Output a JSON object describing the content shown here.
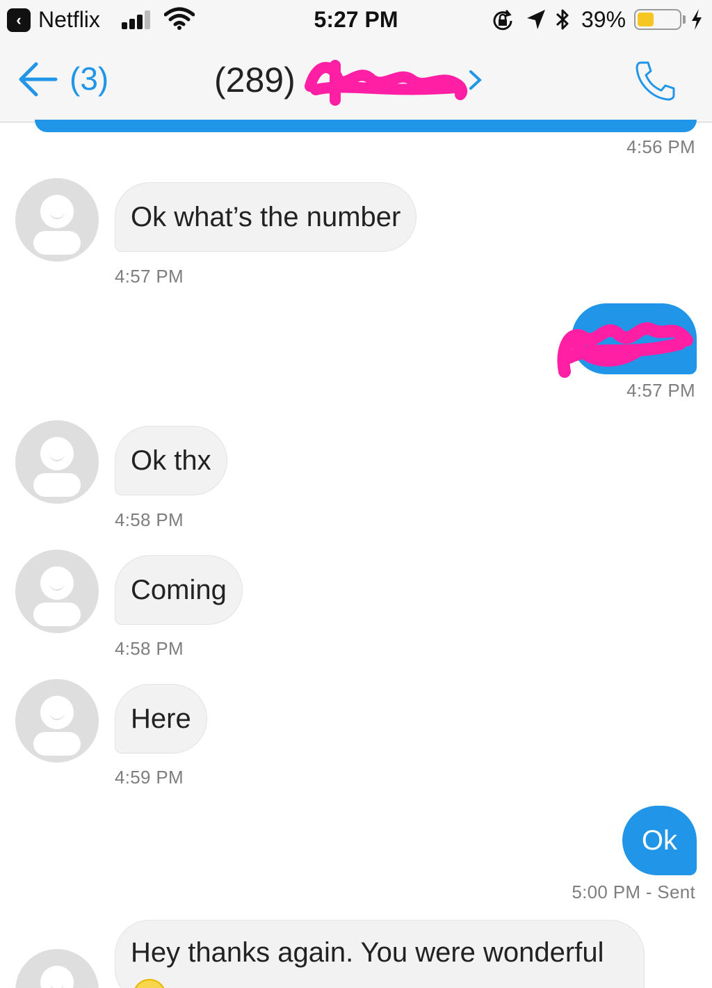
{
  "status_bar": {
    "back_app": "Netflix",
    "time": "5:27 PM",
    "battery_percent": "39%",
    "battery_level": 0.39,
    "battery_color": "#f6c623"
  },
  "nav": {
    "back_count": "(3)",
    "title_prefix": "(289)",
    "title_obscured": true,
    "accent_color": "#2196e8",
    "call_icon": "phone-icon"
  },
  "messages": [
    {
      "direction": "out",
      "text": "",
      "timestamp": "4:56 PM",
      "partial": true
    },
    {
      "direction": "in",
      "text": "Ok what’s the number",
      "timestamp": "4:57 PM"
    },
    {
      "direction": "out",
      "text": "",
      "timestamp": "4:57 PM",
      "obscured": true
    },
    {
      "direction": "in",
      "text": "Ok thx",
      "timestamp": "4:58 PM"
    },
    {
      "direction": "in",
      "text": "Coming",
      "timestamp": "4:58 PM"
    },
    {
      "direction": "in",
      "text": "Here",
      "timestamp": "4:59 PM"
    },
    {
      "direction": "out",
      "text": "Ok",
      "timestamp": "5:00 PM - Sent"
    },
    {
      "direction": "in",
      "text": "Hey thanks again. You were wonderful",
      "emoji": "smiley-emoji"
    }
  ],
  "colors": {
    "outgoing_bubble": "#2196e8",
    "incoming_bubble": "#f2f2f2",
    "redaction": "#ff1fa5"
  }
}
